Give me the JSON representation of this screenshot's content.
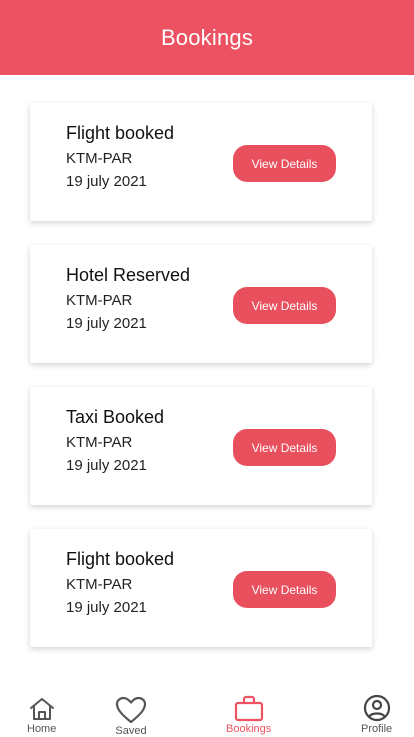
{
  "header": {
    "title": "Bookings"
  },
  "colors": {
    "accent": "#ec5261",
    "button": "#e8505e",
    "text": "#111111"
  },
  "bookings": [
    {
      "title": "Flight booked",
      "route": "KTM-PAR",
      "date": "19 july 2021",
      "button_label": "View Details"
    },
    {
      "title": "Hotel Reserved",
      "route": "KTM-PAR",
      "date": "19 july 2021",
      "button_label": "View Details"
    },
    {
      "title": "Taxi Booked",
      "route": "KTM-PAR",
      "date": "19 july 2021",
      "button_label": "View Details"
    },
    {
      "title": "Flight booked",
      "route": "KTM-PAR",
      "date": "19 july 2021",
      "button_label": "View Details"
    }
  ],
  "nav": [
    {
      "label": "Home",
      "icon": "home-icon",
      "active": false
    },
    {
      "label": "Saved",
      "icon": "heart-icon",
      "active": false
    },
    {
      "label": "Bookings",
      "icon": "briefcase-icon",
      "active": true
    },
    {
      "label": "Profile",
      "icon": "user-circle-icon",
      "active": false
    }
  ]
}
